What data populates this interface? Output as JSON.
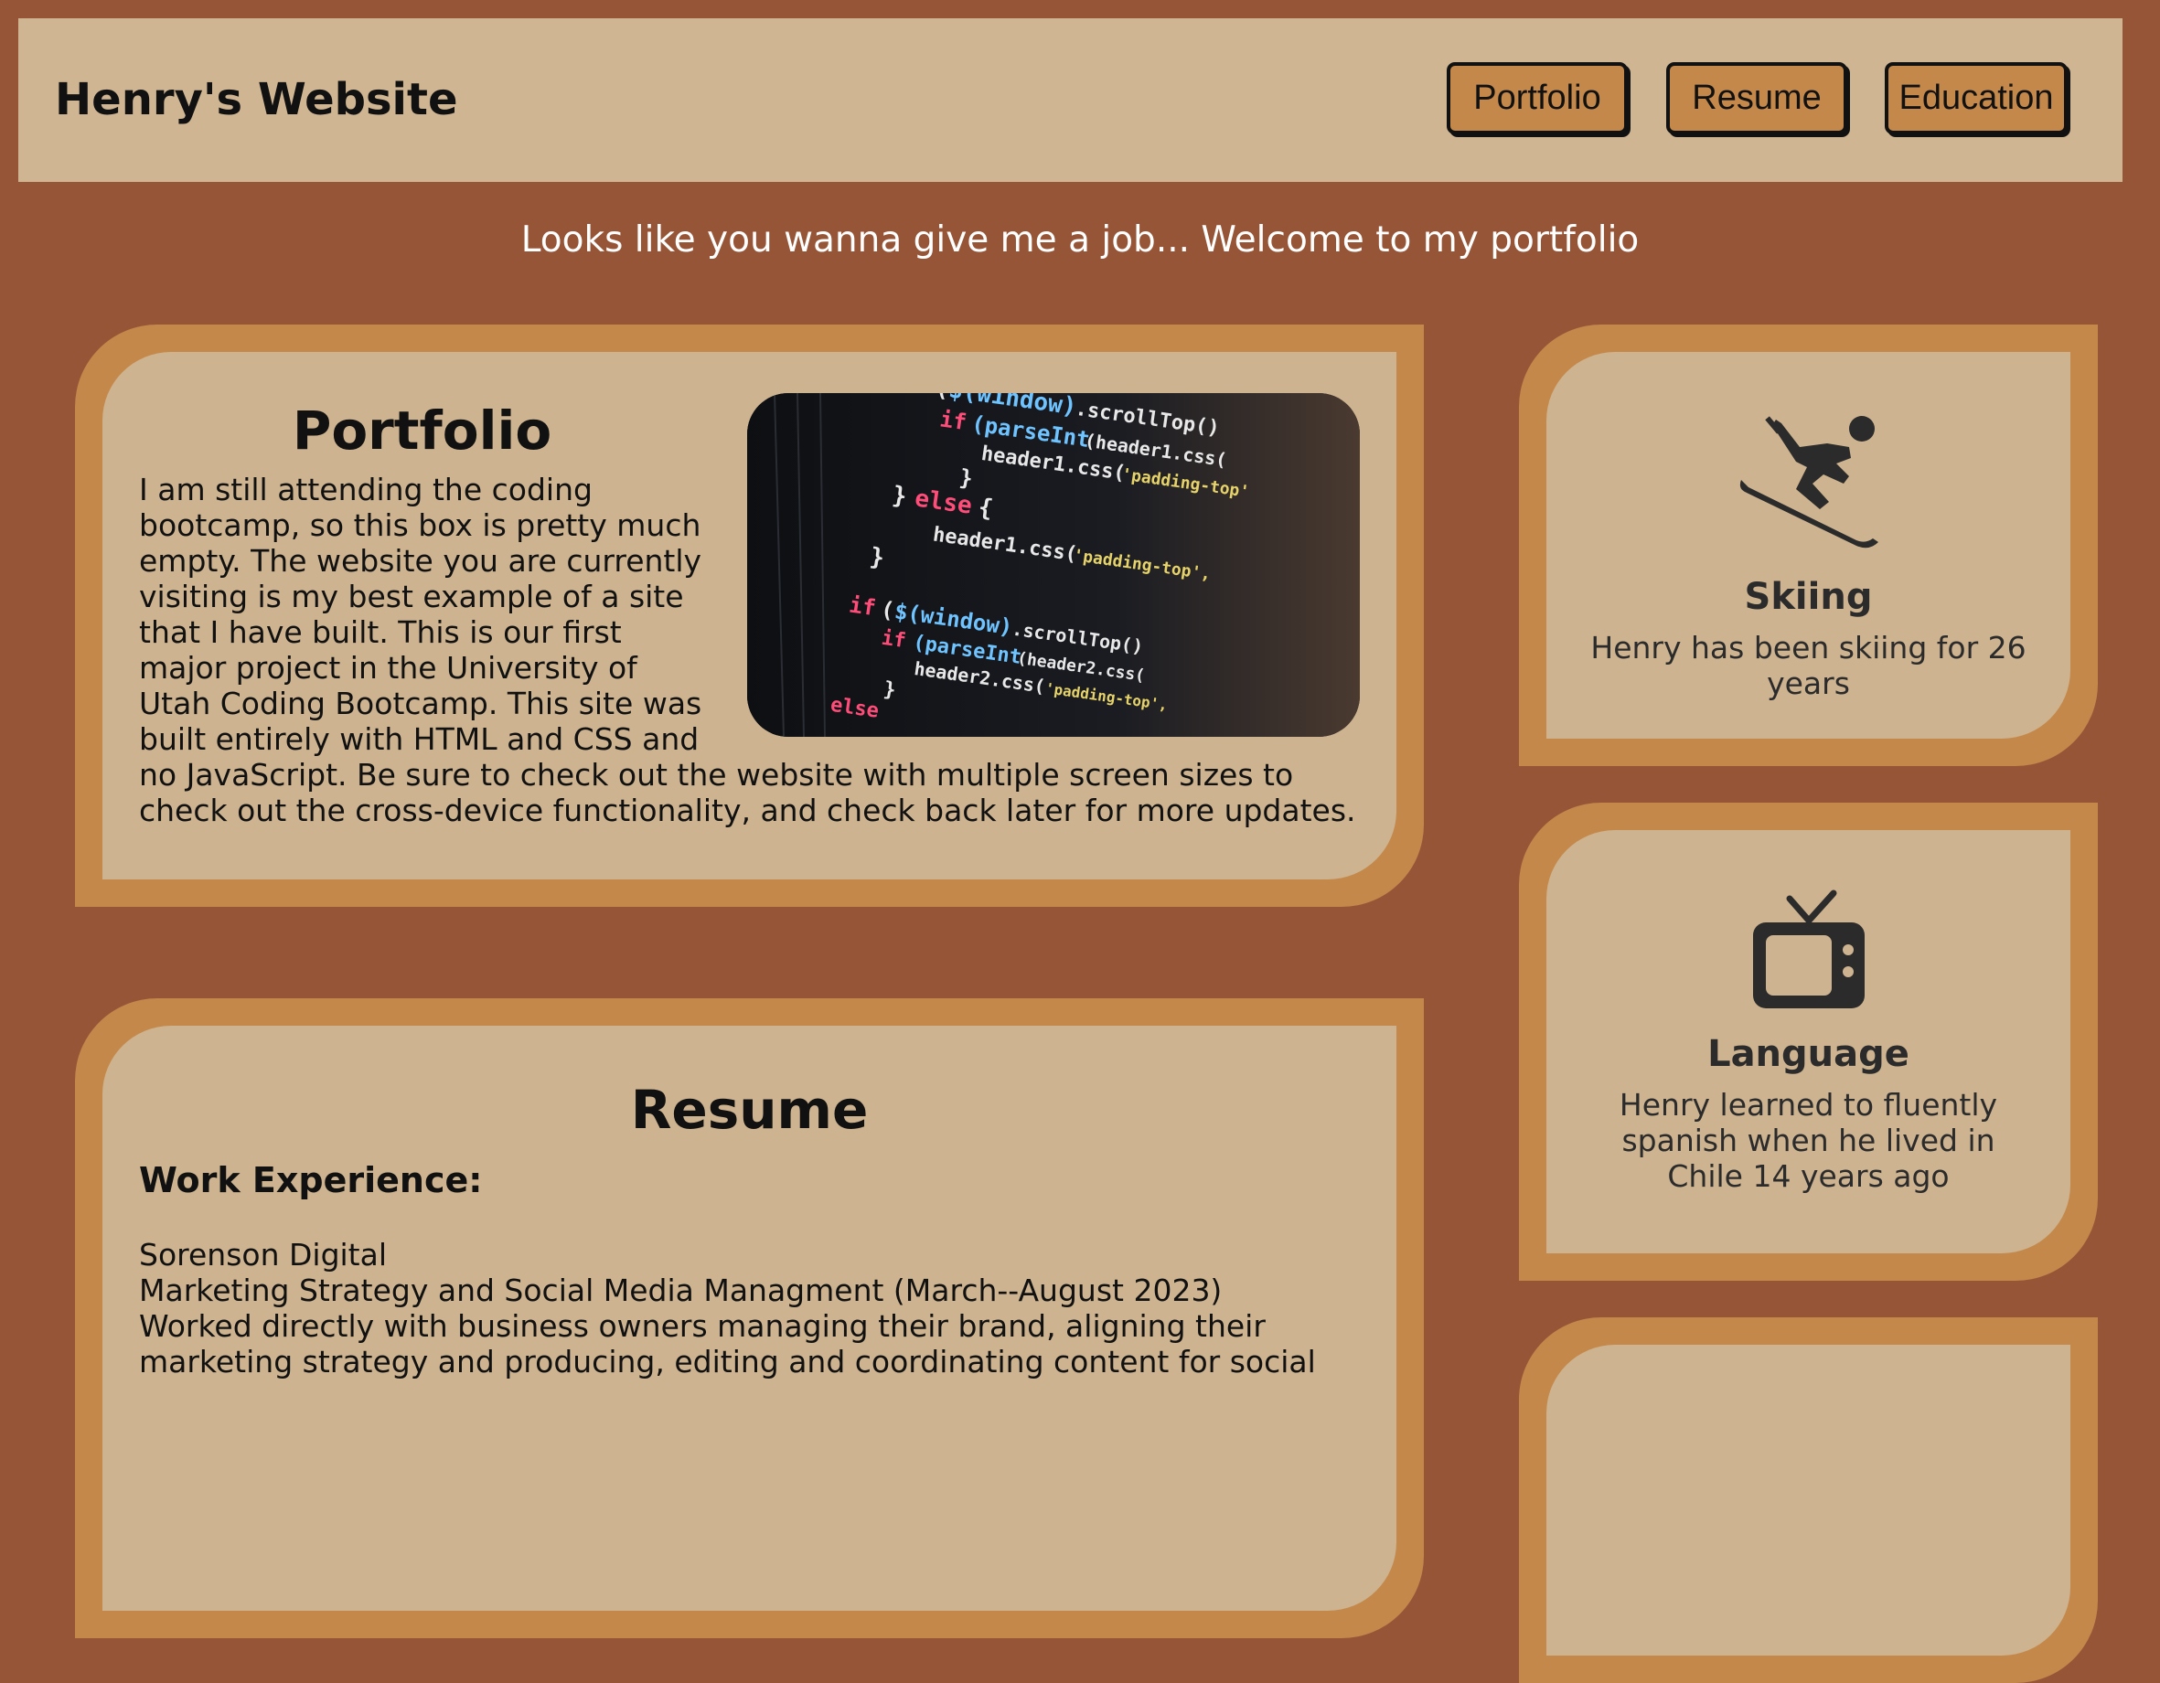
{
  "header": {
    "title": "Henry's Website",
    "nav": [
      {
        "label": "Portfolio"
      },
      {
        "label": "Resume"
      },
      {
        "label": "Education"
      }
    ]
  },
  "tagline": "Looks like you wanna give me a job... Welcome to my portfolio",
  "portfolio": {
    "title": "Portfolio",
    "text": "I am still attending the coding bootcamp, so this box is pretty much empty. The website you are currently visiting is my best example of a site that I have built. This is our first major project in the University of Utah Coding Bootcamp. This site was built entirely with HTML and CSS and no JavaScript. Be sure to check out the website with multiple screen sizes to check out the cross-device functionality, and check back later for more updates.",
    "image_icon": "code-screenshot"
  },
  "resume": {
    "title": "Resume",
    "work_heading": "Work Experience:",
    "company": "Sorenson Digital",
    "role": "Marketing Strategy and Social Media Managment (March--August 2023)",
    "description": "Worked directly with business owners managing their brand, aligning their marketing strategy and producing, editing and coordinating content for social"
  },
  "hobbies": [
    {
      "icon": "skiing-icon",
      "title": "Skiing",
      "text": "Henry has been skiing for 26 years"
    },
    {
      "icon": "tv-icon",
      "title": "Language",
      "text": "Henry learned to fluently spanish when he lived in Chile 14 years ago"
    }
  ],
  "colors": {
    "background": "#975538",
    "header": "#cfb592",
    "card": "#cdb38f",
    "frame": "#c4884b",
    "button": "#c4884b"
  }
}
